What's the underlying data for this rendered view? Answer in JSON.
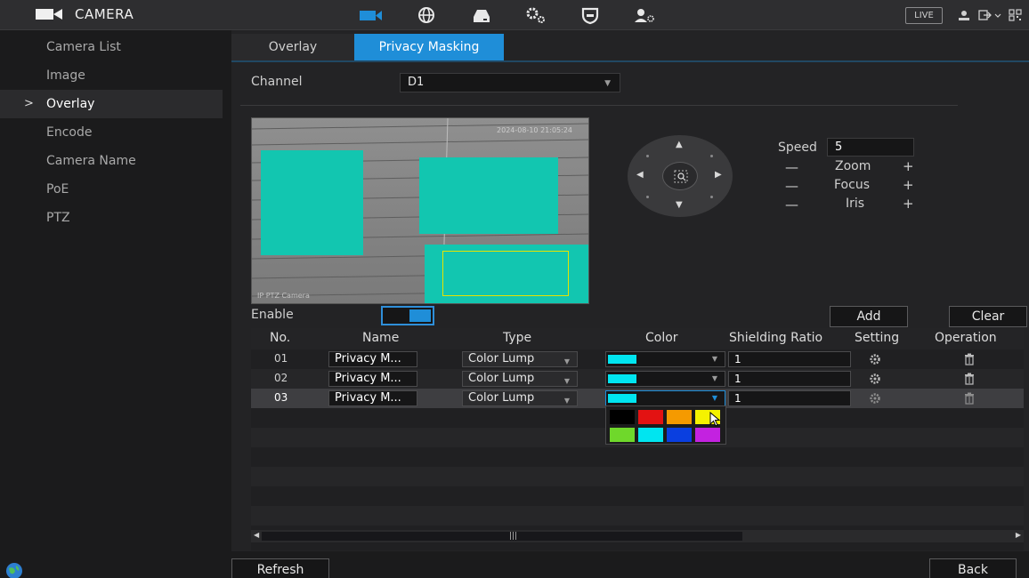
{
  "header": {
    "app_title": "CAMERA",
    "live_label": "LIVE",
    "icons": [
      "camera-icon",
      "network-icon",
      "storage-icon",
      "system-icon",
      "security-icon",
      "account-icon"
    ]
  },
  "sidebar": {
    "items": [
      {
        "label": "Camera List"
      },
      {
        "label": "Image"
      },
      {
        "label": "Overlay",
        "active": true
      },
      {
        "label": "Encode"
      },
      {
        "label": "Camera Name"
      },
      {
        "label": "PoE"
      },
      {
        "label": "PTZ"
      }
    ],
    "active_marker": ">"
  },
  "tabs": [
    {
      "label": "Overlay"
    },
    {
      "label": "Privacy Masking",
      "active": true
    }
  ],
  "channel": {
    "label": "Channel",
    "value": "D1"
  },
  "preview": {
    "osd_time": "2024-08-10 21:05:24",
    "osd_name": "IP PTZ Camera",
    "mask_color": "#12c6b0",
    "selected_outline_color": "#e6e300"
  },
  "ptz": {
    "speed_label": "Speed",
    "speed_value": "5",
    "zoom_label": "Zoom",
    "focus_label": "Focus",
    "iris_label": "Iris",
    "minus": "—",
    "plus": "+"
  },
  "enable": {
    "label": "Enable",
    "on": true
  },
  "buttons": {
    "add": "Add",
    "clear": "Clear",
    "refresh": "Refresh",
    "back": "Back"
  },
  "table": {
    "columns": [
      "No.",
      "Name",
      "Type",
      "Color",
      "Shielding Ratio",
      "Setting",
      "Operation"
    ],
    "rows": [
      {
        "no": "01",
        "name": "Privacy M...",
        "type": "Color Lump",
        "color": "#00e5f0",
        "ratio": "1"
      },
      {
        "no": "02",
        "name": "Privacy M...",
        "type": "Color Lump",
        "color": "#00e5f0",
        "ratio": "1"
      },
      {
        "no": "03",
        "name": "Privacy M...",
        "type": "Color Lump",
        "color": "#00e5f0",
        "ratio": "1",
        "selected": true
      }
    ],
    "palette": [
      "#000000",
      "#e31212",
      "#f59a00",
      "#f5f200",
      "#6fd82b",
      "#00e5f0",
      "#0a3fe0",
      "#c322e0"
    ]
  },
  "colors": {
    "accent": "#1f8ed8"
  }
}
